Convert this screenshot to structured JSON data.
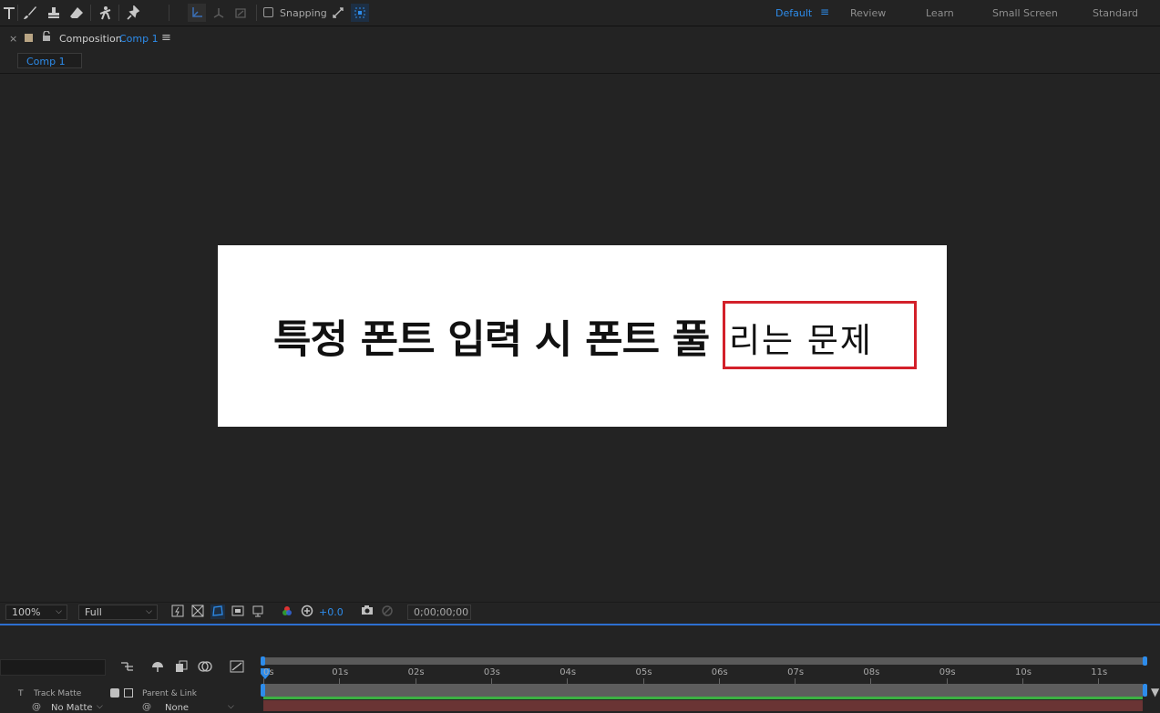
{
  "toolbar": {
    "snapping_label": "Snapping",
    "workspaces": [
      "Default",
      "Review",
      "Learn",
      "Small Screen",
      "Standard"
    ],
    "active_workspace": "Default"
  },
  "panel": {
    "title_prefix": "Composition",
    "comp_name": "Comp 1",
    "tab_label": "Comp 1"
  },
  "canvas": {
    "text_bold": "특정 폰트 입력 시 폰트 풀",
    "text_light": "리는 문제"
  },
  "viewer_bar": {
    "zoom": "100%",
    "resolution": "Full",
    "exposure": "+0.0",
    "timecode": "0;00;00;00"
  },
  "timeline": {
    "ruler_labels": [
      "0s",
      "01s",
      "02s",
      "03s",
      "04s",
      "05s",
      "06s",
      "07s",
      "08s",
      "09s",
      "10s",
      "11s"
    ],
    "col_t": "T",
    "col_track_matte": "Track Matte",
    "col_parent": "Parent & Link",
    "row_matte": "No Matte",
    "row_parent": "None"
  },
  "colors": {
    "accent": "#2d8ceb",
    "highlight_box": "#d3202a",
    "canvas_bg": "#ffffff",
    "work_area_green": "#3cb043",
    "layer_bar": "#6a3434"
  }
}
